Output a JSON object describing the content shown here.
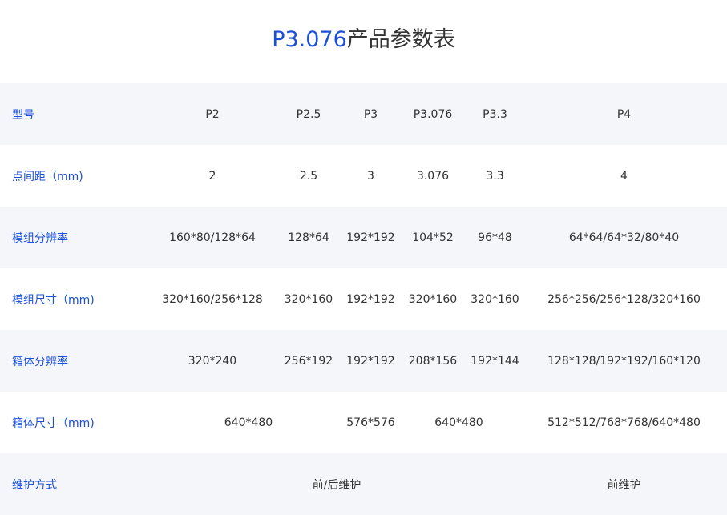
{
  "title": {
    "accent": "P3.076",
    "rest": "产品参数表"
  },
  "rows": [
    {
      "label": "型号",
      "cells": [
        "P2",
        "P2.5",
        "P3",
        "P3.076",
        "P3.3",
        "P4"
      ]
    },
    {
      "label": "点间距（mm)",
      "cells": [
        "2",
        "2.5",
        "3",
        "3.076",
        "3.3",
        "4"
      ]
    },
    {
      "label": "模组分辨率",
      "cells": [
        "160*80/128*64",
        "128*64",
        "192*192",
        "104*52",
        "96*48",
        "64*64/64*32/80*40"
      ]
    },
    {
      "label": "模组尺寸（mm)",
      "cells": [
        "320*160/256*128",
        "320*160",
        "192*192",
        "320*160",
        "320*160",
        "256*256/256*128/320*160"
      ]
    },
    {
      "label": "箱体分辨率",
      "cells": [
        "320*240",
        "256*192",
        "192*192",
        "208*156",
        "192*144",
        "128*128/192*192/160*120"
      ]
    },
    {
      "label": "箱体尺寸（mm)",
      "cells": [
        "640*480",
        "576*576",
        "640*480",
        "512*512/768*768/640*480"
      ]
    },
    {
      "label": "维护方式",
      "cells": [
        "前/后维护",
        "前维护"
      ]
    }
  ],
  "colors": {
    "accent": "#1a4fd6",
    "row_shade": "#f5f6fa",
    "text": "#333333"
  }
}
